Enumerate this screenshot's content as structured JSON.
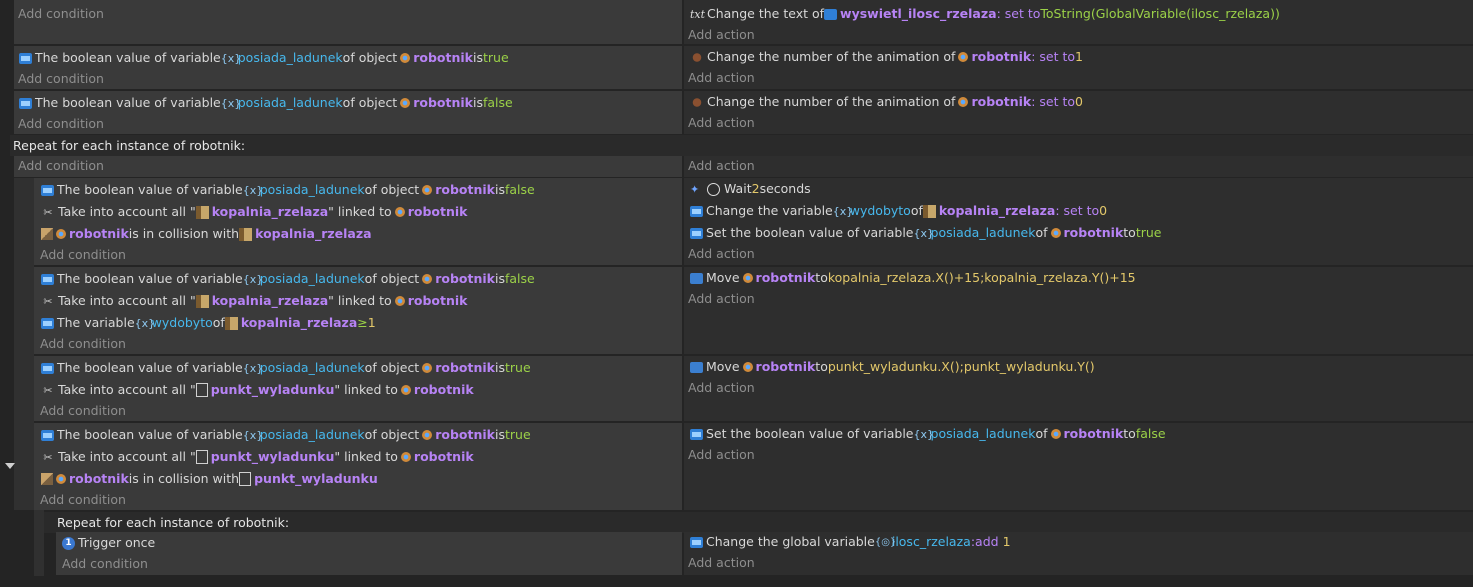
{
  "labels": {
    "add_condition": "Add condition",
    "add_action": "Add action",
    "repeat_header": "Repeat for each instance of robotnik:"
  },
  "events": {
    "e1": {
      "action": {
        "prefix": "Change the text of ",
        "object": "wyswietl_ilosc_rzelaza",
        "suffix": ": set to ",
        "value": "ToString(GlobalVariable(ilosc_rzelaza))"
      }
    },
    "e2": {
      "condition": {
        "prefix": "The boolean value of variable ",
        "variable": "posiada_ladunek",
        "middle": " of object ",
        "object": "robotnik",
        "is": " is ",
        "value": "true"
      },
      "action": {
        "prefix": "Change the number of the animation of ",
        "object": "robotnik",
        "suffix": ": set to ",
        "value": "1"
      }
    },
    "e3": {
      "condition": {
        "prefix": "The boolean value of variable ",
        "variable": "posiada_ladunek",
        "middle": " of object ",
        "object": "robotnik",
        "is": " is ",
        "value": "false"
      },
      "action": {
        "prefix": "Change the number of the animation of ",
        "object": "robotnik",
        "suffix": ": set to ",
        "value": "0"
      }
    },
    "s1": {
      "c1": {
        "prefix": "The boolean value of variable ",
        "variable": "posiada_ladunek",
        "middle": " of object ",
        "object": "robotnik",
        "is": " is ",
        "value": "false"
      },
      "c2": {
        "prefix": "Take into account all \"",
        "object": "kopalnia_rzelaza",
        "middle": "\" linked to ",
        "object2": "robotnik"
      },
      "c3": {
        "object": "robotnik",
        "middle": " is in collision with ",
        "object2": "kopalnia_rzelaza"
      },
      "a1": {
        "prefix": "Wait ",
        "value": "2",
        "suffix": " seconds"
      },
      "a2": {
        "prefix": "Change the variable ",
        "variable": "wydobyto",
        "middle": " of ",
        "object": "kopalnia_rzelaza",
        "suffix": ": set to ",
        "value": "0"
      },
      "a3": {
        "prefix": "Set the boolean value of variable ",
        "variable": "posiada_ladunek",
        "middle": " of ",
        "object": "robotnik",
        "suffix": " to ",
        "value": "true"
      }
    },
    "s2": {
      "c1": {
        "prefix": "The boolean value of variable ",
        "variable": "posiada_ladunek",
        "middle": " of object ",
        "object": "robotnik",
        "is": " is ",
        "value": "false"
      },
      "c2": {
        "prefix": "Take into account all \"",
        "object": "kopalnia_rzelaza",
        "middle": "\" linked to ",
        "object2": "robotnik"
      },
      "c3": {
        "prefix": "The variable ",
        "variable": "wydobyto",
        "middle": " of ",
        "object": "kopalnia_rzelaza",
        "op": " ≥ ",
        "value": "1"
      },
      "a1": {
        "prefix": "Move ",
        "object": "robotnik",
        "middle": " to ",
        "value": "kopalnia_rzelaza.X()+15;kopalnia_rzelaza.Y()+15"
      }
    },
    "s3": {
      "c1": {
        "prefix": "The boolean value of variable ",
        "variable": "posiada_ladunek",
        "middle": " of object ",
        "object": "robotnik",
        "is": " is ",
        "value": "true"
      },
      "c2": {
        "prefix": "Take into account all \"",
        "object": "punkt_wyladunku",
        "middle": "\" linked to ",
        "object2": "robotnik"
      },
      "a1": {
        "prefix": "Move ",
        "object": "robotnik",
        "middle": " to ",
        "value": "punkt_wyladunku.X();punkt_wyladunku.Y()"
      }
    },
    "s4": {
      "c1": {
        "prefix": "The boolean value of variable ",
        "variable": "posiada_ladunek",
        "middle": " of object ",
        "object": "robotnik",
        "is": " is ",
        "value": "true"
      },
      "c2": {
        "prefix": "Take into account all \"",
        "object": "punkt_wyladunku",
        "middle": "\" linked to ",
        "object2": "robotnik"
      },
      "c3": {
        "object": "robotnik",
        "middle": " is in collision with ",
        "object2": "punkt_wyladunku"
      },
      "a1": {
        "prefix": "Set the boolean value of variable ",
        "variable": "posiada_ladunek",
        "middle": " of ",
        "object": "robotnik",
        "suffix": " to ",
        "value": "false"
      }
    },
    "s5": {
      "c1": {
        "text": "Trigger once"
      },
      "a1": {
        "prefix": "Change the global variable ",
        "variable": "ilosc_rzelaza",
        "suffix": ": ",
        "op": "add",
        "value": "1"
      }
    }
  }
}
